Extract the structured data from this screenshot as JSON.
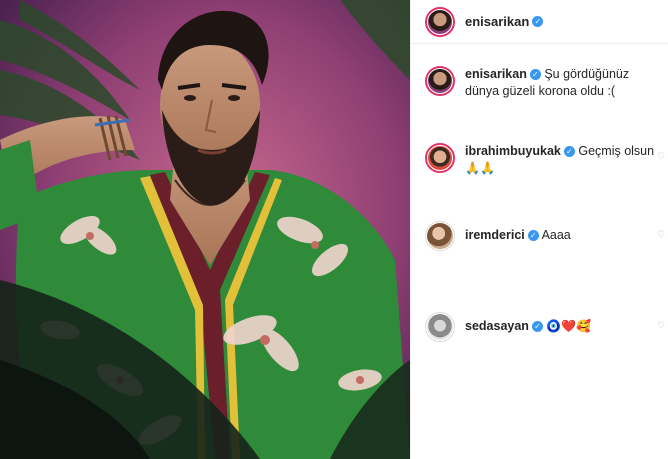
{
  "post": {
    "username": "enisarikan",
    "verified": true
  },
  "comments": [
    {
      "username": "enisarikan",
      "text": "Şu gördüğünüz dünya güzeli korona oldu :("
    },
    {
      "username": "ibrahimbuyukak",
      "text": "Geçmiş olsun",
      "emoji": "🙏🙏"
    },
    {
      "username": "iremderici",
      "text": "Aaaa"
    },
    {
      "username": "sedasayan",
      "emoji": "🧿❤️🥰"
    }
  ],
  "icons": {
    "verified": "verified-badge-icon",
    "like": "heart-outline-icon"
  },
  "colors": {
    "accent": "#3897f0",
    "story_ring": "#e0356a",
    "background_photo": "#8a3f78",
    "shirt": "#2f8a3a"
  }
}
